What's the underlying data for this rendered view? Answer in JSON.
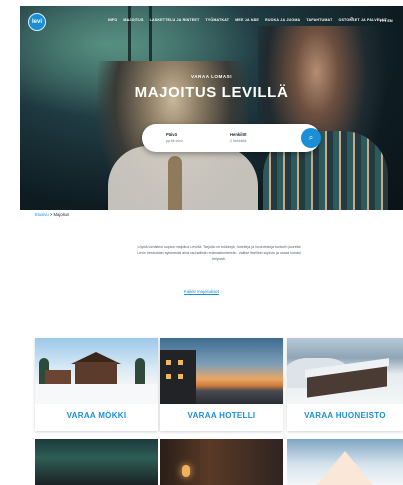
{
  "logo_text": "levi",
  "nav": {
    "items": [
      "INFO",
      "MAJOITUS",
      "LASKETTELU JA RINTEET",
      "TYÖMATKAT",
      "MEE JA NÄE",
      "RUOKA JA JUOMA",
      "TAPAHTUMAT",
      "OSTOKSET JA PALVELUT"
    ],
    "search_icon": "search-icon",
    "language": "FI ▾ EN"
  },
  "hero": {
    "eyebrow": "VARAA LOMASI",
    "title": "MAJOITUS LEVILLÄ",
    "search": {
      "checkin_label": "Päivä",
      "checkin_value": "pp.kk.vvvv",
      "guests_label": "Henkilöt",
      "guests_value": "2 henkilöä",
      "button_icon": "search-icon"
    }
  },
  "breadcrumb": {
    "home": "Etusivu",
    "separator": " > ",
    "current": "Majoitus"
  },
  "intro": {
    "text": "Löydä lomallesi sopiva majoitus Leviltä. Tarjolla on mökkejä, hotelleja ja huoneistoja tunturin juurelta Levin keskustan sykkeestä aina rauhallisiin erämaakohteisiin. Valitse itsellesi sopivin ja varaa lomasi helposti.",
    "link": "Kaikki majoitukset"
  },
  "cards": [
    {
      "title": "VARAA MÖKKI"
    },
    {
      "title": "VARAA HOTELLI"
    },
    {
      "title": "VARAA HUONEISTO"
    }
  ],
  "colors": {
    "accent": "#1a8fd6",
    "text": "#1d2b36"
  }
}
